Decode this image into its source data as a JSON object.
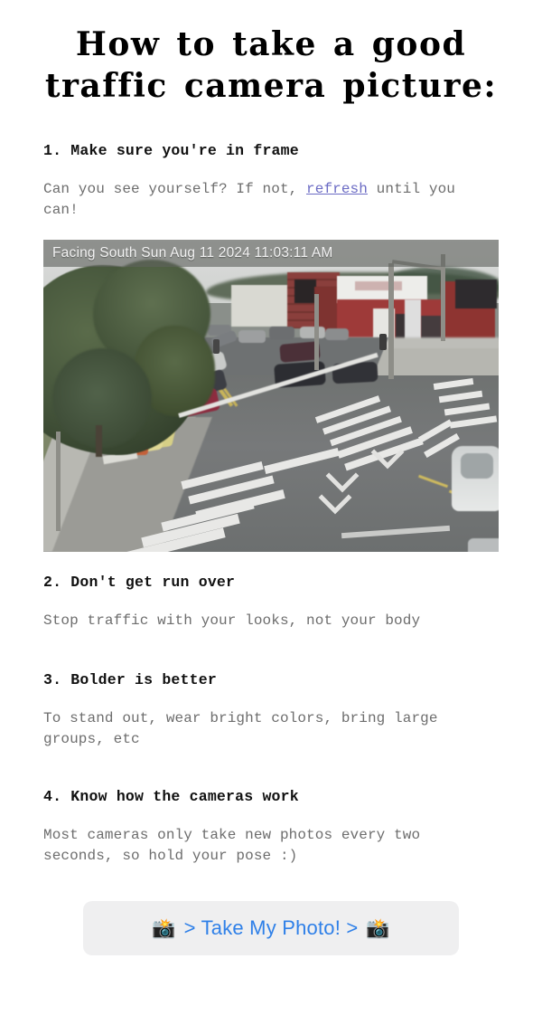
{
  "page": {
    "title": "How to take a good traffic camera picture:",
    "background_color": "#ffffff"
  },
  "steps": [
    {
      "heading": "1. Make sure you're in frame",
      "body_before_link": "Can you see yourself? If not, ",
      "link_text": "refresh",
      "body_after_link": "\nuntil you can!"
    },
    {
      "heading": "2. Don't get run over",
      "body": "Stop traffic with your looks, not your body"
    },
    {
      "heading": "3. Bolder is better",
      "body": "To stand out, wear bright colors, bring large groups, etc"
    },
    {
      "heading": "4. Know how the cameras work",
      "body": "Most cameras only take new photos every two seconds, so hold your pose :)"
    }
  ],
  "camera": {
    "overlay_text": "Facing South Sun Aug 11 2024 11:03:11 AM",
    "direction": "Facing South",
    "day": "Sun",
    "month": "Aug",
    "date": "11",
    "year": "2024",
    "time": "11:03:11 AM",
    "alt": "Traffic camera view of a street intersection with crosswalks, parked cars, construction barriers and red brick storefronts"
  },
  "cta": {
    "label": "> Take My Photo! >",
    "emoji_left": "📸",
    "emoji_right": "📸",
    "text_color": "#2f80e8",
    "background_color": "#efeff0"
  },
  "colors": {
    "heading": "#111111",
    "body_text": "#6d6d6d",
    "link": "#6b6bc4",
    "accent_blue": "#2f80e8"
  }
}
